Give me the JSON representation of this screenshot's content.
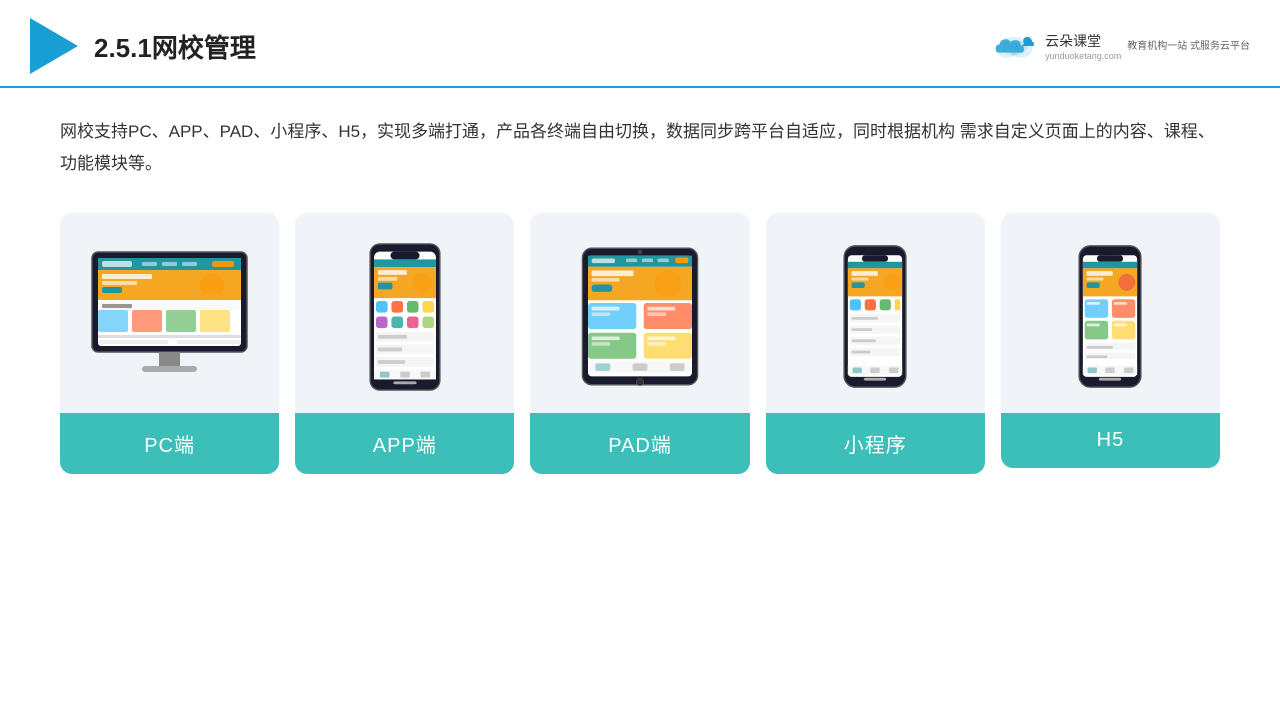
{
  "header": {
    "title": "2.5.1网校管理",
    "brand": {
      "name": "云朵课堂",
      "url": "yunduoketang.com",
      "tagline": "教育机构一站\n式服务云平台"
    }
  },
  "description": "网校支持PC、APP、PAD、小程序、H5，实现多端打通，产品各终端自由切换，数据同步跨平台自适应，同时根据机构\n需求自定义页面上的内容、课程、功能模块等。",
  "cards": [
    {
      "id": "pc",
      "label": "PC端"
    },
    {
      "id": "app",
      "label": "APP端"
    },
    {
      "id": "pad",
      "label": "PAD端"
    },
    {
      "id": "miniapp",
      "label": "小程序"
    },
    {
      "id": "h5",
      "label": "H5"
    }
  ],
  "colors": {
    "accent": "#1a9fd4",
    "card_bg": "#f0f4f8",
    "label_bg": "#3bbfb8",
    "label_text": "#ffffff"
  }
}
